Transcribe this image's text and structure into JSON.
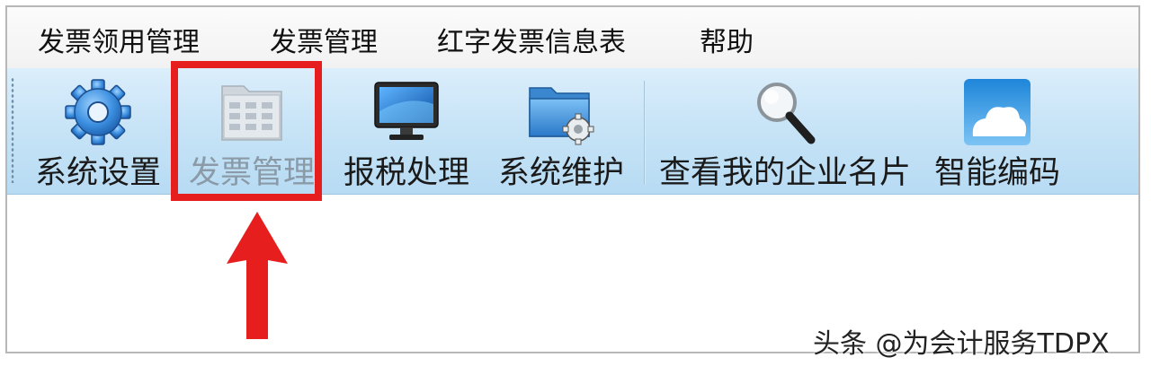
{
  "menu": {
    "items": [
      {
        "label": "发票领用管理"
      },
      {
        "label": "发票管理"
      },
      {
        "label": "红字发票信息表"
      },
      {
        "label": "帮助"
      }
    ]
  },
  "toolbar": {
    "buttons": [
      {
        "label": "系统设置",
        "icon": "gear-icon",
        "enabled": true
      },
      {
        "label": "发票管理",
        "icon": "invoice-grid-icon",
        "enabled": false
      },
      {
        "label": "报税处理",
        "icon": "monitor-icon",
        "enabled": true
      },
      {
        "label": "系统维护",
        "icon": "folder-gear-icon",
        "enabled": true
      },
      {
        "label": "查看我的企业名片",
        "icon": "magnifier-icon",
        "enabled": true
      },
      {
        "label": "智能编码",
        "icon": "cloud-icon",
        "enabled": true
      }
    ]
  },
  "annotation": {
    "highlight_color": "#e61e1e"
  },
  "watermark": {
    "text": "头条 @为会计服务TDPX"
  },
  "colors": {
    "toolbar_bg": "#c8e4f7",
    "menubar_bg": "#f2f2f2"
  }
}
